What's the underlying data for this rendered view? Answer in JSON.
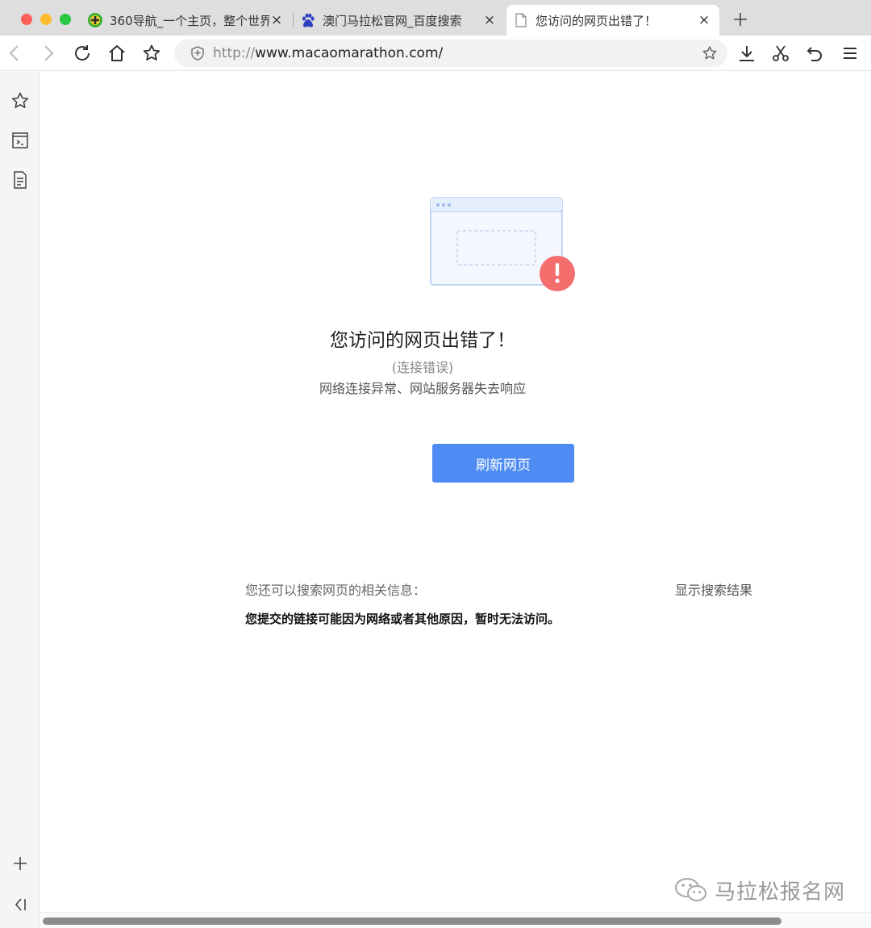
{
  "tabs": [
    {
      "title": "360导航_一个主页，整个世界",
      "favicon": "360-logo-icon",
      "active": false
    },
    {
      "title": "澳门马拉松官网_百度搜索",
      "favicon": "baidu-paw-icon",
      "active": false
    },
    {
      "title": "您访问的网页出错了！",
      "favicon": "page-icon",
      "active": true
    }
  ],
  "tab_close_glyph": "×",
  "toolbar": {
    "url_scheme": "http://",
    "url_rest": "www.macaomarathon.com/"
  },
  "error_page": {
    "title": "您访问的网页出错了！",
    "subtitle": "(连接错误)",
    "description": "网络连接异常、网站服务器失去响应",
    "refresh_label": "刷新网页",
    "search_hint": "您还可以搜索网页的相关信息：",
    "show_results_label": "显示搜索结果",
    "note": "您提交的链接可能因为网络或者其他原因，暂时无法访问。"
  },
  "watermark": {
    "text": "马拉松报名网",
    "icon": "wechat-icon"
  },
  "colors": {
    "accent": "#4e8cf3",
    "error_badge": "#f56e6e",
    "traffic_red": "#fe5f57",
    "traffic_yellow": "#febc2e",
    "traffic_green": "#28c840"
  }
}
